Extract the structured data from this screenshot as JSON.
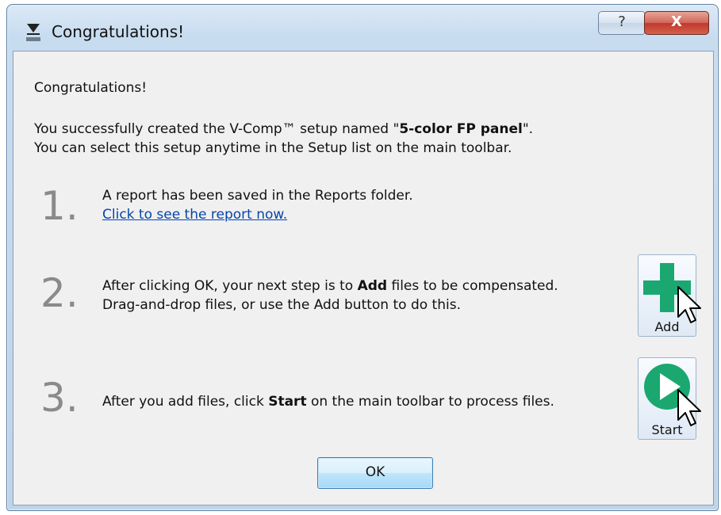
{
  "window": {
    "title": "Congratulations!",
    "help_label": "?",
    "close_label": "X"
  },
  "body": {
    "heading": "Congratulations!",
    "line1_prefix": "You successfully created the V-Comp™ setup named \"",
    "setup_name": "5-color FP panel",
    "line1_suffix": "\".",
    "line2": "You can select this setup anytime in the Setup list on the main toolbar."
  },
  "steps": [
    {
      "number": "1",
      "text": "A report has been saved in the Reports folder.",
      "link": "Click to see the report now."
    },
    {
      "number": "2",
      "text_prefix": "After clicking OK, your next step is to ",
      "text_bold": "Add",
      "text_suffix": " files to be compensated.",
      "text_line2": "Drag-and-drop files, or use the Add button to do this.",
      "button_label": "Add"
    },
    {
      "number": "3",
      "text_prefix": "After you add files, click ",
      "text_bold": "Start",
      "text_suffix": " on the main toolbar to process files.",
      "button_label": "Start"
    }
  ],
  "ok_label": "OK",
  "colors": {
    "accent_green": "#1aa870",
    "link": "#0645ad",
    "step_number": "#8a8a8a"
  }
}
